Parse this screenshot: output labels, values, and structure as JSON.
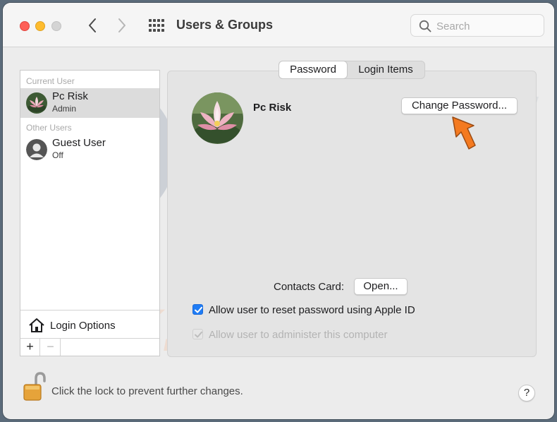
{
  "window": {
    "title": "Users & Groups",
    "search_placeholder": "Search"
  },
  "sidebar": {
    "current_user_label": "Current User",
    "other_users_label": "Other Users",
    "users": [
      {
        "name": "Pc Risk",
        "role": "Admin",
        "selected": true
      },
      {
        "name": "Guest User",
        "role": "Off",
        "selected": false
      }
    ],
    "login_options_label": "Login Options",
    "add_label": "+",
    "remove_label": "−"
  },
  "tabs": [
    {
      "label": "Password",
      "active": true
    },
    {
      "label": "Login Items",
      "active": false
    }
  ],
  "main": {
    "user_name": "Pc Risk",
    "change_password_label": "Change Password...",
    "contacts_card_label": "Contacts Card:",
    "open_label": "Open...",
    "allow_reset_label": "Allow user to reset password using Apple ID",
    "allow_reset_checked": true,
    "allow_admin_label": "Allow user to administer this computer",
    "allow_admin_checked": true,
    "allow_admin_disabled": true
  },
  "footer": {
    "lock_text": "Click the lock to prevent further changes.",
    "help_label": "?"
  },
  "colors": {
    "accent": "#1f7cf5",
    "annotation_arrow": "#f47a20"
  },
  "icons": {
    "back": "chevron-left-icon",
    "forward": "chevron-right-icon",
    "grid": "grid-icon",
    "search": "magnifier-icon",
    "home": "house-icon",
    "lock": "unlocked-padlock-icon"
  }
}
